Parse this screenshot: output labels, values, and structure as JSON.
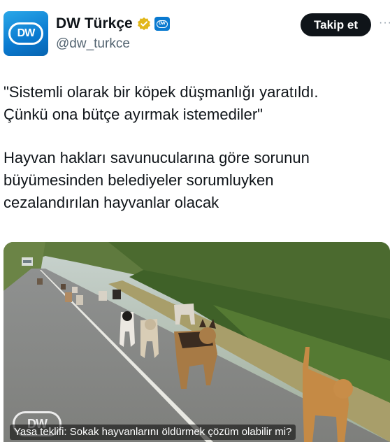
{
  "account": {
    "display_name": "DW Türkçe",
    "handle": "@dw_turkce",
    "avatar_text": "DW",
    "badge_text": "DW"
  },
  "actions": {
    "follow_label": "Takip et",
    "more_label": "···"
  },
  "tweet": {
    "paragraph1_line1": "\"Sistemli olarak bir köpek düşmanlığı yaratıldı.",
    "paragraph1_line2": "Çünkü ona bütçe ayırmak istemediler\"",
    "paragraph2_line1": "Hayvan hakları savunucularına göre sorunun",
    "paragraph2_line2": "büyümesinden belediyeler sorumluyken",
    "paragraph2_line3": "cezalandırılan hayvanlar olacak"
  },
  "media": {
    "caption": "Yasa teklifi: Sokak hayvanlarını öldürmek çözüm olabilir mi?",
    "watermark": "DW"
  },
  "colors": {
    "brand": "#0a7ad0",
    "verified_gold": "#e2b719",
    "text_primary": "#0f1419",
    "text_secondary": "#536471"
  }
}
